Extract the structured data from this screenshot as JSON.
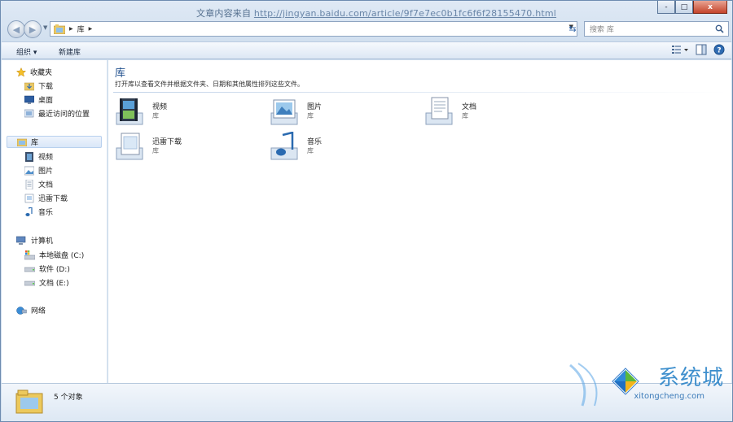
{
  "window": {
    "caption_prefix": "文章内容来自",
    "caption_url": "http://jingyan.baidu.com/article/9f7e7ec0b1fc6f6f28155470.html",
    "controls": {
      "minimize": "-",
      "maximize": "□",
      "close": "x"
    }
  },
  "address": {
    "crumb": "库",
    "search_placeholder": "搜索 库"
  },
  "toolbar": {
    "organize_label": "组织 ▾",
    "new_library_label": "新建库"
  },
  "sidebar": {
    "favorites": {
      "header": "收藏夹",
      "items": [
        "下载",
        "桌面",
        "最近访问的位置"
      ]
    },
    "libraries": {
      "header": "库",
      "items": [
        "视频",
        "图片",
        "文档",
        "迅雷下载",
        "音乐"
      ]
    },
    "computer": {
      "header": "计算机",
      "items": [
        "本地磁盘 (C:)",
        "软件 (D:)",
        "文档 (E:)"
      ]
    },
    "network": {
      "header": "网络"
    }
  },
  "content": {
    "title": "库",
    "description": "打开库以查看文件并根据文件夹、日期和其他属性排列这些文件。",
    "libraries": [
      {
        "name": "视频",
        "type": "库",
        "icon": "video-library-icon"
      },
      {
        "name": "图片",
        "type": "库",
        "icon": "pictures-library-icon"
      },
      {
        "name": "文档",
        "type": "库",
        "icon": "documents-library-icon"
      },
      {
        "name": "迅雷下载",
        "type": "库",
        "icon": "download-library-icon"
      },
      {
        "name": "音乐",
        "type": "库",
        "icon": "music-library-icon"
      }
    ]
  },
  "details": {
    "count": "5 个对象"
  },
  "watermark": {
    "brand": "系统城",
    "site": "xitongcheng.com"
  }
}
